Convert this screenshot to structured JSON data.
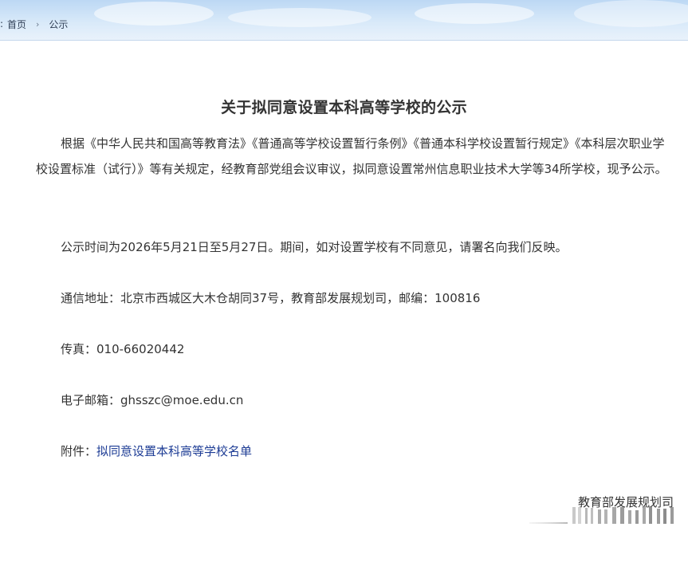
{
  "header": {
    "breadcrumb_prefix": ":",
    "breadcrumb": [
      "首页",
      "公示"
    ]
  },
  "article": {
    "title": "关于拟同意设置本科高等学校的公示",
    "intro": "根据《中华人民共和国高等教育法》《普通高等学校设置暂行条例》《普通本科学校设置暂行规定》《本科层次职业学校设置标准（试行）》等有关规定，经教育部党组会议审议，拟同意设置常州信息职业技术大学等34所学校，现予公示。",
    "publicity_period": "公示时间为2026年5月21日至5月27日。期间，如对设置学校有不同意见，请署名向我们反映。",
    "address_label": "通信地址：",
    "address": "北京市西城区大木仓胡同37号，教育部发展规划司，邮编：100816",
    "fax_label": "传真：",
    "fax": "010-66020442",
    "email_label": "电子邮箱：",
    "email": "ghsszc@moe.edu.cn",
    "attachment_label": "附件：",
    "attachment_link": "拟同意设置本科高等学校名单",
    "signature": "教育部发展规划司"
  },
  "colors": {
    "header_blue": "#bcd8f4",
    "text": "#333333",
    "link": "#1d3c95"
  }
}
